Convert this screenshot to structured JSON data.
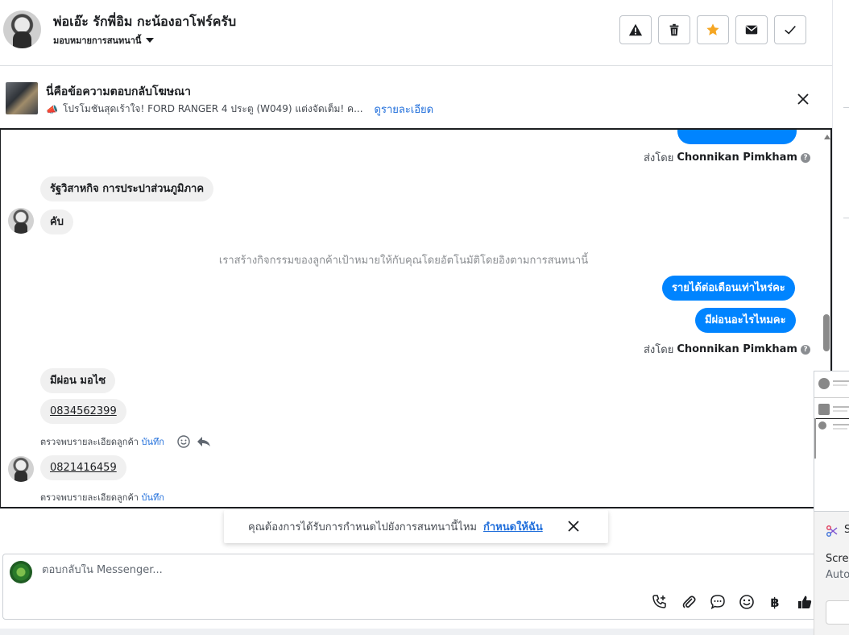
{
  "header": {
    "contact_name": "พ่อเอ๊ะ รักพี่อิม กะน้องอาโฟร์ครับ",
    "assign_label": "มอบหมายการสนทนานี้",
    "actions": [
      "warning-icon",
      "trash-icon",
      "star-icon",
      "envelope-icon",
      "check-icon"
    ],
    "star_color": "#f5a623"
  },
  "ad": {
    "title": "นี่คือข้อความตอบกลับโฆษณา",
    "description": "โปรโมชันสุดเร้าใจ! FORD RANGER 4 ประตู (W049) แต่งจัดเต็ม! ค...",
    "link": "ดูรายละเอียด"
  },
  "messages": {
    "sent_by_prefix": "ส่งโดย",
    "agent_name": "Chonnikan Pimkham",
    "in_1": "รัฐวิสาหกิจ การประปาส่วนภูมิภาค",
    "in_2": "คับ",
    "system_note": "เราสร้างกิจกรรมของลูกค้าเป้าหมายให้กับคุณโดยอัตโนมัติโดยอิงตามการสนทนานี้",
    "out_1": "รายได้ต่อเดือนเท่าไหร่คะ",
    "out_2": "มีผ่อนอะไรไหมคะ",
    "in_3": "มีผ่อน มอไซ",
    "in_4": "0834562399",
    "detected_text": "ตรวจพบรายละเอียดลูกค้า",
    "save_link": "บันทึก",
    "in_5": "0821416459",
    "out_color": "#0084ff"
  },
  "reminder": {
    "text": "คุณต้องการได้รับการกำหนดไปยังการสนทนานี้ไหม",
    "link": "กำหนดให้ฉัน"
  },
  "composer": {
    "placeholder": "ตอบกลับใน Messenger...",
    "tools": [
      "phone-plus-icon",
      "paperclip-icon",
      "chat-bubble-icon",
      "emoji-icon",
      "baht-icon",
      "thumbs-up-icon"
    ],
    "baht_symbol": "฿"
  },
  "snip": {
    "title_fragment": "S",
    "line1": "Scree",
    "line2": "Auto"
  }
}
